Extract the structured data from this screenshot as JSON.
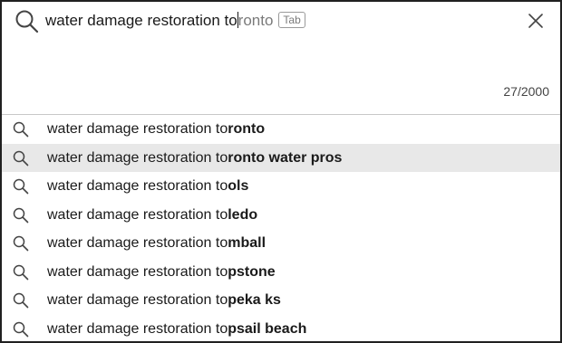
{
  "search": {
    "typed": "water damage restoration to",
    "completion": "ronto",
    "tab_hint": "Tab",
    "char_count": "27/2000"
  },
  "suggestions": [
    {
      "prefix": "water damage restoration to",
      "rest": "ronto",
      "highlighted": false
    },
    {
      "prefix": "water damage restoration to",
      "rest": "ronto water pros",
      "highlighted": true
    },
    {
      "prefix": "water damage restoration to",
      "rest": "ols",
      "highlighted": false
    },
    {
      "prefix": "water damage restoration to",
      "rest": "ledo",
      "highlighted": false
    },
    {
      "prefix": "water damage restoration to",
      "rest": "mball",
      "highlighted": false
    },
    {
      "prefix": "water damage restoration to",
      "rest": "pstone",
      "highlighted": false
    },
    {
      "prefix": "water damage restoration to",
      "rest": "peka ks",
      "highlighted": false
    },
    {
      "prefix": "water damage restoration to",
      "rest": "psail beach",
      "highlighted": false
    }
  ],
  "icons": {
    "search": "search-icon",
    "close": "close-icon"
  },
  "colors": {
    "highlight_row": "#e8e8e8",
    "completion_text": "#7a7a7a"
  }
}
